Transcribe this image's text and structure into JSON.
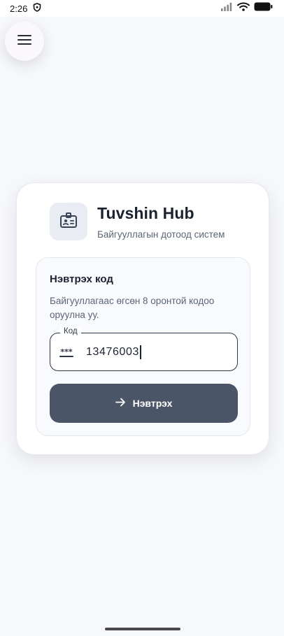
{
  "status_bar": {
    "time": "2:26",
    "icons": [
      "shield-icon",
      "signal-icon",
      "wifi-icon",
      "battery-icon"
    ]
  },
  "menu": {
    "icon": "hamburger-icon"
  },
  "brand": {
    "icon": "badge-icon",
    "title": "Tuvshin Hub",
    "subtitle": "Байгууллагын дотоод систем"
  },
  "login": {
    "heading": "Нэвтрэх код",
    "description": "Байгууллагаас өгсөн 8 оронтой кодоо оруулна уу.",
    "field": {
      "label": "Код",
      "icon": "password-icon",
      "value": "13476003"
    },
    "submit": {
      "icon": "arrow-right-icon",
      "label": "Нэвтрэх"
    }
  },
  "colors": {
    "background": "#f7f8fb",
    "button": "#4a5568",
    "field_border": "#2d3646",
    "title": "#1b2230",
    "muted": "#5b6678"
  }
}
